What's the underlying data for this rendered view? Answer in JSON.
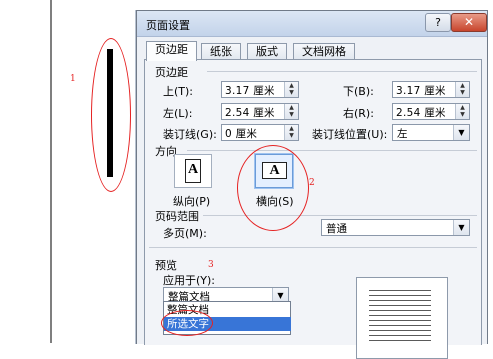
{
  "dialog": {
    "title": "页面设置",
    "help_label": "?",
    "close_label": "✕",
    "tabs": [
      "页边距",
      "纸张",
      "版式",
      "文档网格"
    ]
  },
  "margins": {
    "section_label": "页边距",
    "top": {
      "label": "上(T):",
      "value": "3.17 厘米"
    },
    "bottom": {
      "label": "下(B):",
      "value": "3.17 厘米"
    },
    "left": {
      "label": "左(L):",
      "value": "2.54 厘米"
    },
    "right": {
      "label": "右(R):",
      "value": "2.54 厘米"
    },
    "gutter": {
      "label": "装订线(G):",
      "value": "0 厘米"
    },
    "gutter_pos": {
      "label": "装订线位置(U):",
      "value": "左"
    }
  },
  "orientation": {
    "section_label": "方向",
    "portrait": {
      "label": "纵向(P)",
      "glyph": "A"
    },
    "landscape": {
      "label": "横向(S)",
      "glyph": "A"
    }
  },
  "pages": {
    "section_label": "页码范围",
    "multiple_label": "多页(M):",
    "multiple_value": "普通"
  },
  "preview": {
    "section_label": "预览",
    "apply_label": "应用于(Y):",
    "apply_value": "整篇文档",
    "options": [
      "整篇文档",
      "所选文字"
    ]
  },
  "annotations": [
    "1",
    "2",
    "3"
  ]
}
